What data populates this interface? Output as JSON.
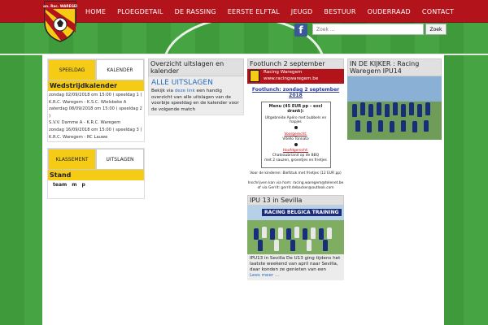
{
  "nav": {
    "items": [
      "HOME",
      "PLOEGDETAIL",
      "DE RASSING",
      "EERSTE ELFTAL",
      "JEUGD",
      "BESTUUR",
      "OUDERRAAD",
      "CONTACT"
    ]
  },
  "logo": {
    "text": "Kon. Rac. WAREGEM"
  },
  "search": {
    "placeholder": "Zoek ...",
    "button_label": "Zoek"
  },
  "colors": {
    "brand_red": "#b3141c",
    "accent_yellow": "#f5cb16",
    "link_blue": "#2a6ebb"
  },
  "wedstrijd": {
    "tab_active": "SPEELDAG",
    "tab_inactive": "KALENDER",
    "title": "Wedstrijdkalender",
    "lines": [
      "zondag 02/09/2018 om 15:00  ( speeldag 1 )",
      "K.R.C. Waregem - K.S.C. Wielsbeke A",
      "zaterdag 08/09/2018 om 15:00  ( speeldag 2 )",
      "S.V.V. Damme A - K.R.C. Waregem",
      "zondag 16/09/2018 om 15:00  ( speeldag 3 )",
      "K.R.C. Waregem - RC Lauwe"
    ]
  },
  "klassement": {
    "tab_active": "KLASSEMENT",
    "tab_inactive": "UITSLAGEN",
    "title": "Stand",
    "columns": [
      "team",
      "m",
      "p"
    ]
  },
  "overzicht": {
    "title": "Overzicht uitslagen en kalender",
    "link_title": "ALLE UITSLAGEN",
    "text_pre": "Bekijk via ",
    "text_link": "deze link",
    "text_post": " een handig overzicht van alle uitslagen van de voorbije speeldag en de kalender voor de volgende match"
  },
  "footlunch": {
    "title": "Footlunch 2 september",
    "banner_line1": "Racing Waregem",
    "banner_line2": "www.racingwaregem.be",
    "date": "Footlunch: zondag 2 september 2018",
    "menu_title": "Menu (45 EUR pp – excl drank):",
    "menu_lines": [
      "Uitgebreide Apéro met bubbels en hapjes",
      "Voorgerecht:",
      "Vitello Tonnato",
      "Hoofdgerecht:",
      "Chateaubriand op de BBQ",
      "met 2 sauzen, groentjes en frietjes"
    ],
    "kids": "Voor de kinderen: Biefstuk met frietjes (12 EUR pp)",
    "register1": "Inschrijven kan via hom: racing.waregem@telenet.be",
    "register2": "of via Gerrit: gerrit.debacker@outlook.com"
  },
  "ipu": {
    "title": "IPU 13 in Sevilla",
    "photo_label": "RACING BELGICA TRAINING",
    "text": "IPU13 in Sevilla   De U13 ging tijdens het laatste weekend van april naar Sevilla, daar konden ze genieten van een",
    "more": "Lees meer ..."
  },
  "kijker": {
    "title": "IN DE KIJKER : Racing Waregem IPU14"
  }
}
